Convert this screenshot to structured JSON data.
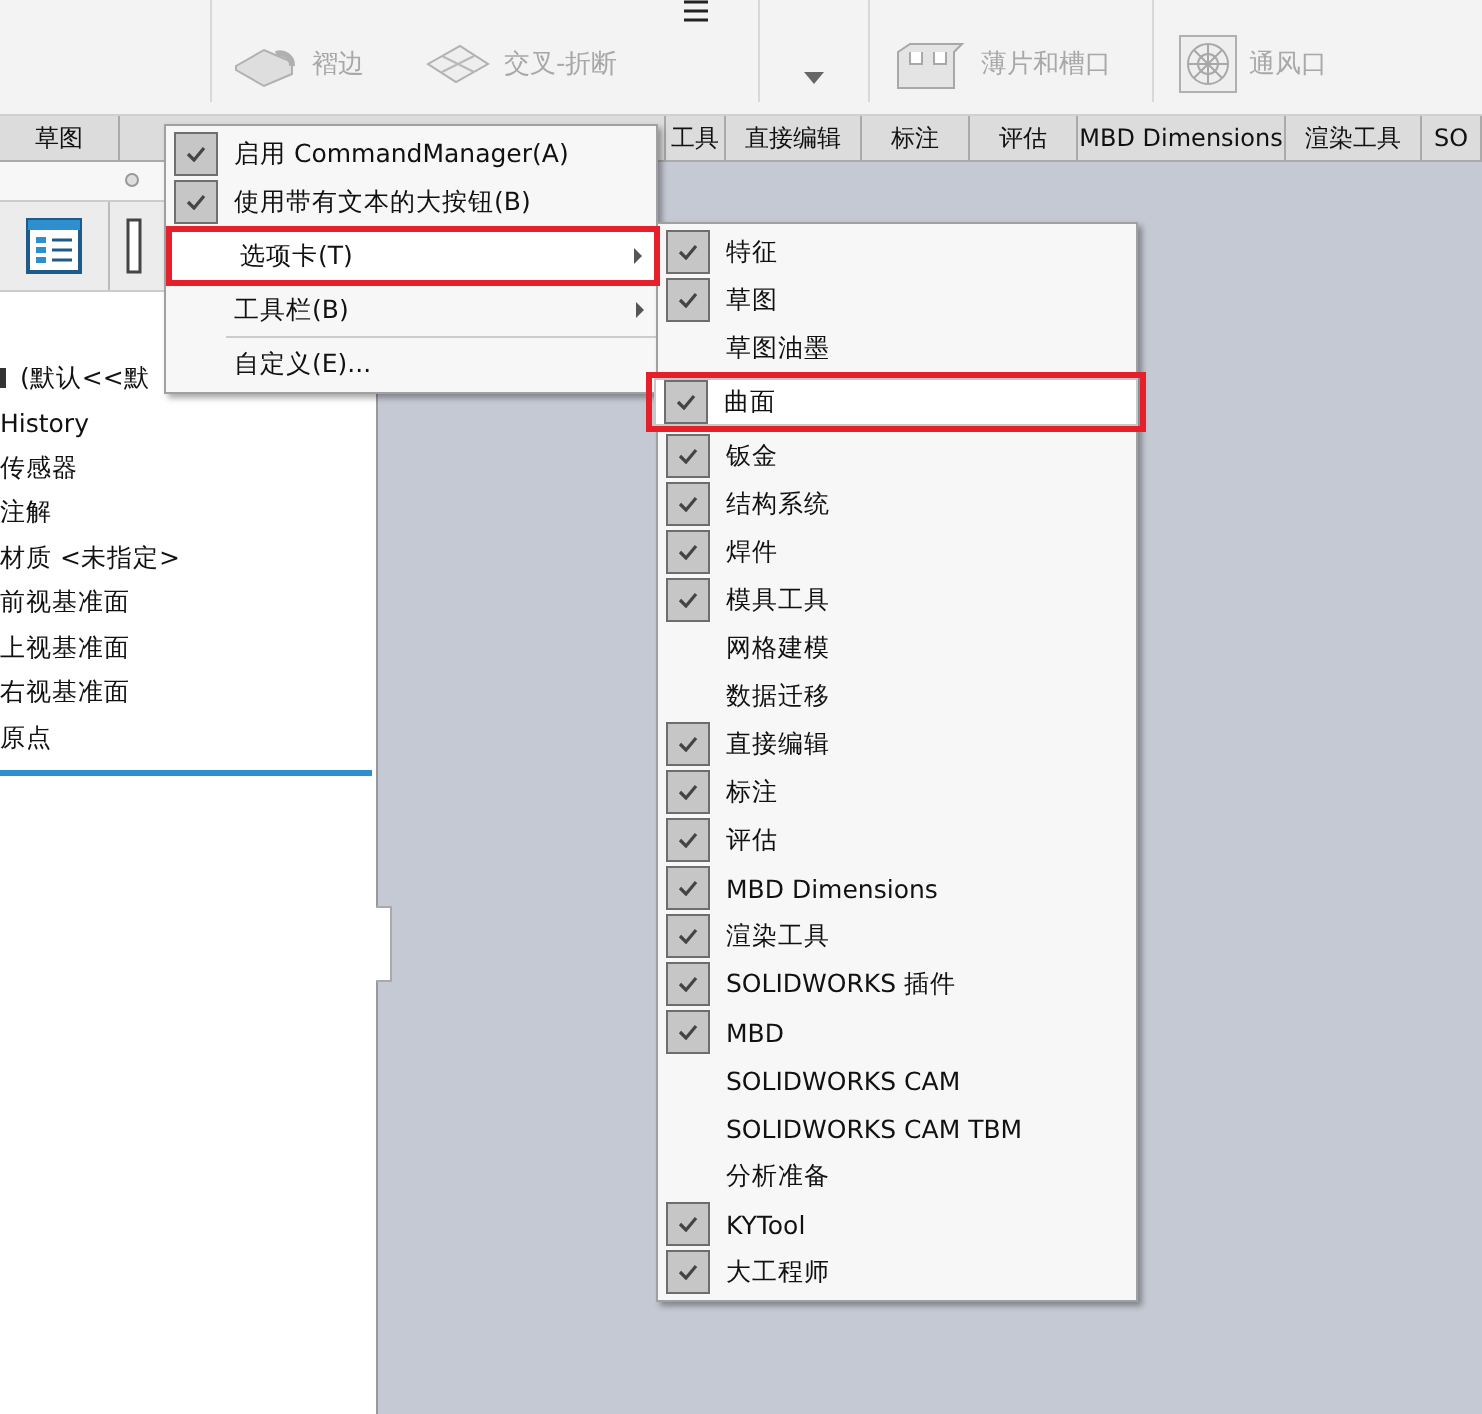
{
  "ribbon": {
    "tools": [
      {
        "label": "褶边",
        "kind": "hem"
      },
      {
        "label": "交叉-折断",
        "kind": "cross"
      },
      {
        "label": "薄片和槽口",
        "kind": "tab"
      },
      {
        "label": "通风口",
        "kind": "vent"
      }
    ]
  },
  "tabs": [
    {
      "label": "草图"
    },
    {
      "label": "工具"
    },
    {
      "label": "直接编辑"
    },
    {
      "label": "标注"
    },
    {
      "label": "评估"
    },
    {
      "label": "MBD Dimensions"
    },
    {
      "label": "渲染工具"
    },
    {
      "label": "SO"
    }
  ],
  "tree": {
    "items": [
      {
        "label": "(默认<<默",
        "kind": "part"
      },
      {
        "label": "History",
        "kind": "item"
      },
      {
        "label": "传感器",
        "kind": "item"
      },
      {
        "label": "注解",
        "kind": "item"
      },
      {
        "label": "材质 <未指定>",
        "kind": "item"
      },
      {
        "label": "前视基准面",
        "kind": "item"
      },
      {
        "label": "上视基准面",
        "kind": "item"
      },
      {
        "label": "右视基准面",
        "kind": "item"
      },
      {
        "label": "原点",
        "kind": "item"
      }
    ]
  },
  "context_menu": {
    "items": [
      {
        "label": "启用 CommandManager(A)",
        "checked": true,
        "submenu": false,
        "highlighted": false
      },
      {
        "label": "使用带有文本的大按钮(B)",
        "checked": true,
        "submenu": false,
        "highlighted": false
      },
      {
        "label": "选项卡(T)",
        "checked": false,
        "submenu": true,
        "highlighted": true
      },
      {
        "label": "工具栏(B)",
        "checked": false,
        "submenu": true,
        "highlighted": false
      },
      {
        "label": "自定义(E)...",
        "checked": false,
        "submenu": false,
        "highlighted": false
      }
    ]
  },
  "tabs_submenu": {
    "items": [
      {
        "label": "特征",
        "checked": true,
        "highlighted": false
      },
      {
        "label": "草图",
        "checked": true,
        "highlighted": false
      },
      {
        "label": "草图油墨",
        "checked": false,
        "highlighted": false
      },
      {
        "label": "曲面",
        "checked": true,
        "highlighted": true
      },
      {
        "label": "钣金",
        "checked": true,
        "highlighted": false
      },
      {
        "label": "结构系统",
        "checked": true,
        "highlighted": false
      },
      {
        "label": "焊件",
        "checked": true,
        "highlighted": false
      },
      {
        "label": "模具工具",
        "checked": true,
        "highlighted": false
      },
      {
        "label": "网格建模",
        "checked": false,
        "highlighted": false
      },
      {
        "label": "数据迁移",
        "checked": false,
        "highlighted": false
      },
      {
        "label": "直接编辑",
        "checked": true,
        "highlighted": false
      },
      {
        "label": "标注",
        "checked": true,
        "highlighted": false
      },
      {
        "label": "评估",
        "checked": true,
        "highlighted": false
      },
      {
        "label": "MBD Dimensions",
        "checked": true,
        "highlighted": false
      },
      {
        "label": "渲染工具",
        "checked": true,
        "highlighted": false
      },
      {
        "label": "SOLIDWORKS 插件",
        "checked": true,
        "highlighted": false
      },
      {
        "label": "MBD",
        "checked": true,
        "highlighted": false
      },
      {
        "label": "SOLIDWORKS CAM",
        "checked": false,
        "highlighted": false
      },
      {
        "label": "SOLIDWORKS CAM TBM",
        "checked": false,
        "highlighted": false
      },
      {
        "label": "分析准备",
        "checked": false,
        "highlighted": false
      },
      {
        "label": "KYTool",
        "checked": true,
        "highlighted": false
      },
      {
        "label": "大工程师",
        "checked": true,
        "highlighted": false
      }
    ]
  }
}
